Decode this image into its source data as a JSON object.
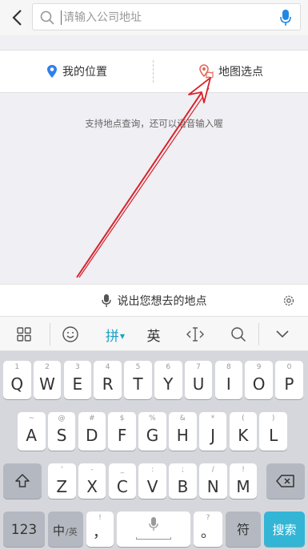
{
  "header": {
    "back_icon": "chevron-left-icon",
    "search_placeholder": "请输入公司地址",
    "mic_icon": "microphone-icon",
    "mic_color": "#1e88e5"
  },
  "location": {
    "my_location_label": "我的位置",
    "my_location_icon": "location-pin-icon",
    "map_select_label": "地图选点",
    "map_select_icon": "map-pin-icon"
  },
  "tip": "支持地点查询，还可以语音输入喔",
  "voice_bar": {
    "label": "说出您想去的地点",
    "settings_icon": "gear-icon"
  },
  "ime_toolbar": {
    "grid_icon": "grid-icon",
    "emoji_icon": "emoji-icon",
    "pinyin_label": "拼",
    "english_label": "英",
    "cursor_icon": "cursor-move-icon",
    "search_icon": "search-icon",
    "collapse_icon": "chevron-down-icon",
    "accent_color": "#1da1c8"
  },
  "keyboard": {
    "row1": [
      {
        "main": "Q",
        "hint": "1"
      },
      {
        "main": "W",
        "hint": "2"
      },
      {
        "main": "E",
        "hint": "3"
      },
      {
        "main": "R",
        "hint": "4"
      },
      {
        "main": "T",
        "hint": "5"
      },
      {
        "main": "Y",
        "hint": "6"
      },
      {
        "main": "U",
        "hint": "7"
      },
      {
        "main": "I",
        "hint": "8"
      },
      {
        "main": "O",
        "hint": "9"
      },
      {
        "main": "P",
        "hint": "0"
      }
    ],
    "row2": [
      {
        "main": "A",
        "hint": "~"
      },
      {
        "main": "S",
        "hint": "@"
      },
      {
        "main": "D",
        "hint": "#"
      },
      {
        "main": "F",
        "hint": "$"
      },
      {
        "main": "G",
        "hint": "%"
      },
      {
        "main": "H",
        "hint": "&"
      },
      {
        "main": "J",
        "hint": "*"
      },
      {
        "main": "K",
        "hint": "("
      },
      {
        "main": "L",
        "hint": ")"
      }
    ],
    "row3": [
      {
        "main": "Z",
        "hint": "'"
      },
      {
        "main": "X",
        "hint": "-"
      },
      {
        "main": "C",
        "hint": "_"
      },
      {
        "main": "V",
        "hint": ":"
      },
      {
        "main": "B",
        "hint": ";"
      },
      {
        "main": "N",
        "hint": "/"
      },
      {
        "main": "M",
        "hint": "!"
      }
    ],
    "shift_icon": "shift-icon",
    "backspace_icon": "backspace-icon",
    "num_label": "123",
    "lang_label_main": "中",
    "lang_label_sub": "/英",
    "comma_label": "，",
    "comma_hint": "!",
    "space_icon": "microphone-icon",
    "period_label": "。",
    "period_hint": "?",
    "symbol_label": "符",
    "search_label": "搜索",
    "search_color": "#33b5d6"
  }
}
